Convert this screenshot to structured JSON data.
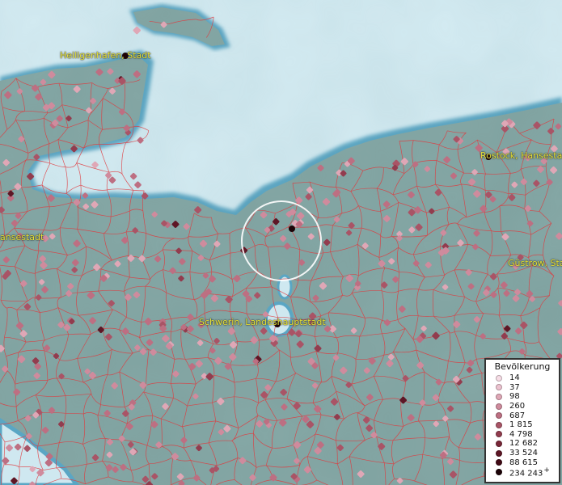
{
  "map": {
    "place_labels": [
      {
        "id": "heiligenhafen",
        "text": "Heiligenhafen, Stadt"
      },
      {
        "id": "hansestadt-west",
        "text": "ansestadt"
      },
      {
        "id": "rostock",
        "text": "Rostock, Hansestadt"
      },
      {
        "id": "guestrow",
        "text": "Güstrow, Stad"
      },
      {
        "id": "schwerin",
        "text": "Schwerin, Landeshauptstadt"
      }
    ],
    "colors": {
      "sea": "#d4ebf2",
      "coast": "#5aa6c4",
      "land": "#8aa9a7",
      "borders": "#e0393d",
      "label": "#e6e23a"
    }
  },
  "legend": {
    "title": "Bevölkerung",
    "items": [
      {
        "label": "14",
        "color": "#f7dde6"
      },
      {
        "label": "37",
        "color": "#ecc2cf"
      },
      {
        "label": "98",
        "color": "#dfa7b6"
      },
      {
        "label": "260",
        "color": "#cf8b9d"
      },
      {
        "label": "687",
        "color": "#bd6f82"
      },
      {
        "label": "1 815",
        "color": "#a95466"
      },
      {
        "label": "4 798",
        "color": "#923c4e"
      },
      {
        "label": "12 682",
        "color": "#792738"
      },
      {
        "label": "33 524",
        "color": "#5e1625"
      },
      {
        "label": "88 615",
        "color": "#410a15"
      },
      {
        "label": "234 243",
        "color": "#1c0307",
        "plus": "+"
      }
    ]
  }
}
